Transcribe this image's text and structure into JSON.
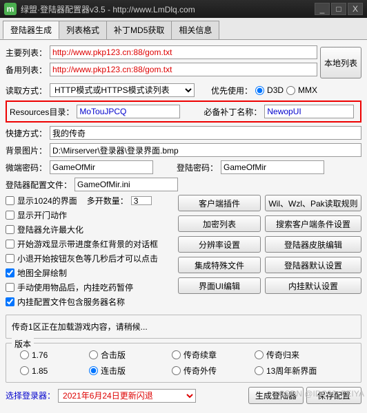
{
  "window": {
    "logo_text": "m",
    "title": "绿盟·登陆器配置器v3.5 - http://www.LmDlq.com",
    "min": "_",
    "max": "□",
    "close": "X"
  },
  "tabs": [
    "登陆器生成",
    "列表格式",
    "补丁MD5获取",
    "相关信息"
  ],
  "labels": {
    "main_list": "主要列表：",
    "backup_list": "备用列表：",
    "read_mode": "读取方式：",
    "prefer": "优先使用：",
    "res_dir": "Resources目录：",
    "patch_name": "必备补丁名称：",
    "shortcut": "快捷方式：",
    "bg_image": "背景图片：",
    "micro_pw": "微端密码：",
    "login_pw": "登陆密码：",
    "cfg_file": "登陆器配置文件：",
    "multi_open": "多开数量：",
    "select_login": "选择登录器：",
    "d3d": "D3D",
    "mmx": "MMX"
  },
  "values": {
    "main_list": "http://www.pkp123.cn:88/gom.txt",
    "backup_list": "http://www.pkp123.cn:88/gom.txt",
    "read_mode": "HTTP模式或HTTPS模式读列表",
    "res_dir": "MoTouJPCQ",
    "patch_name": "NewopUI",
    "shortcut": "我的传奇",
    "bg_image": "D:\\Mirserver\\登录器\\登录界面.bmp",
    "micro_pw": "GameOfMir",
    "login_pw": "GameOfMir",
    "cfg_file": "GameOfMir.ini",
    "multi_open": "3",
    "select_login": "2021年6月24日更新闪退"
  },
  "buttons": {
    "local_list": "本地列表",
    "client_plugin": "客户端插件",
    "wil_rule": "Wil、Wzl、Pak读取规则",
    "enc_list": "加密列表",
    "search_cond": "搜索客户端条件设置",
    "res_set": "分辨率设置",
    "skin_edit": "登陆器皮肤编辑",
    "sp_file": "集成特殊文件",
    "def_set": "登陆器默认设置",
    "ui_edit": "界面UI编辑",
    "ng_def": "内挂默认设置",
    "gen_login": "生成登陆器",
    "save_cfg": "保存配置"
  },
  "checks": {
    "show1024": "显示1024的界面",
    "show_action": "显示开门动作",
    "allow_max": "登陆器允许最大化",
    "start_red": "开始游戏显示带进度条红背景的对话框",
    "small_exit": "小退开始按钮灰色等几秒后才可以点击",
    "fullscreen": "地图全屏绘制",
    "hand_item": "手动使用物品后，内挂吃药暂停",
    "ng_cfg": "内挂配置文件包含服务器名称"
  },
  "status": "传奇1区正在加载游戏内容，请稍候...",
  "version": {
    "legend": "版本",
    "v176": "1.76",
    "v185": "1.85",
    "hs": "合击版",
    "lj": "连击版",
    "xz": "传奇续章",
    "wz": "传奇外传",
    "gl": "传奇归来",
    "anniv": "13周年新界面"
  },
  "watermark": "CSDN @IDC02_FEIYA"
}
